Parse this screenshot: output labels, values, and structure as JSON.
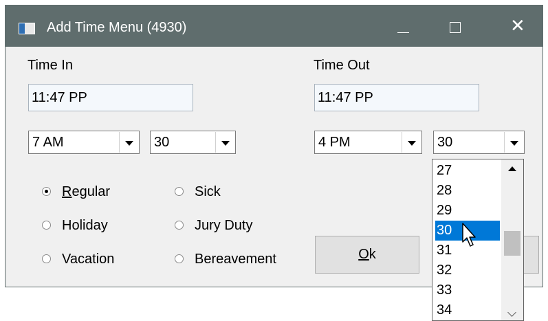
{
  "window": {
    "title": "Add Time Menu (4930)",
    "controls": {
      "minimize": "–",
      "maximize": "☐",
      "close": "✕"
    }
  },
  "time_in": {
    "label": "Time In",
    "value": "11:47 PP",
    "hour": "7 AM",
    "minute": "30"
  },
  "time_out": {
    "label": "Time Out",
    "value": "11:47 PP",
    "hour": "4 PM",
    "minute": "30"
  },
  "types": {
    "selected": "Regular",
    "regular": {
      "mnemonic": "R",
      "rest": "egular"
    },
    "holiday": "Holiday",
    "vacation": "Vacation",
    "sick": "Sick",
    "jury_duty": "Jury Duty",
    "bereavement": "Bereavement"
  },
  "buttons": {
    "ok": {
      "mnemonic": "O",
      "rest": "k"
    }
  },
  "minute_dropdown": {
    "items": [
      "27",
      "28",
      "29",
      "30",
      "31",
      "32",
      "33",
      "34"
    ],
    "highlighted": "30"
  },
  "colors": {
    "titlebar": "#5f6d6d",
    "highlight": "#0078d7",
    "dialog_bg": "#f0f0f0"
  }
}
